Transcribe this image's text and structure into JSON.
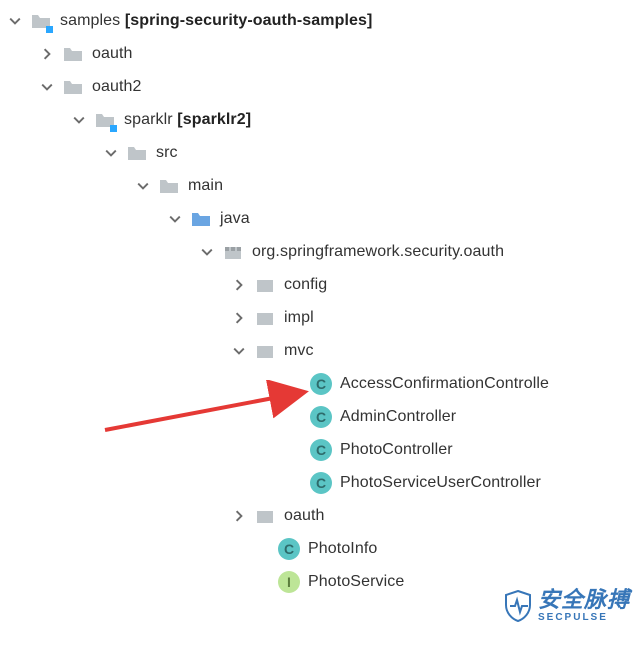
{
  "tree": {
    "root": {
      "name": "samples",
      "bracket": "[spring-security-oauth-samples]"
    },
    "oauth": {
      "name": "oauth"
    },
    "oauth2": {
      "name": "oauth2"
    },
    "sparklr": {
      "name": "sparklr",
      "bracket": "[sparklr2]"
    },
    "src": {
      "name": "src"
    },
    "main": {
      "name": "main"
    },
    "java": {
      "name": "java"
    },
    "pkg": {
      "name": "org.springframework.security.oauth"
    },
    "config": {
      "name": "config"
    },
    "impl": {
      "name": "impl"
    },
    "mvc": {
      "name": "mvc"
    },
    "classes": {
      "access": "AccessConfirmationControlle",
      "admin": "AdminController",
      "photo": "PhotoController",
      "psu": "PhotoServiceUserController"
    },
    "oauthpkg": {
      "name": "oauth"
    },
    "files": {
      "photoinfo": "PhotoInfo",
      "photoservice": "PhotoService"
    }
  },
  "glyphs": {
    "c": "C",
    "i": "I"
  },
  "watermark": {
    "cn": "安全脉搏",
    "en": "SECPULSE"
  }
}
